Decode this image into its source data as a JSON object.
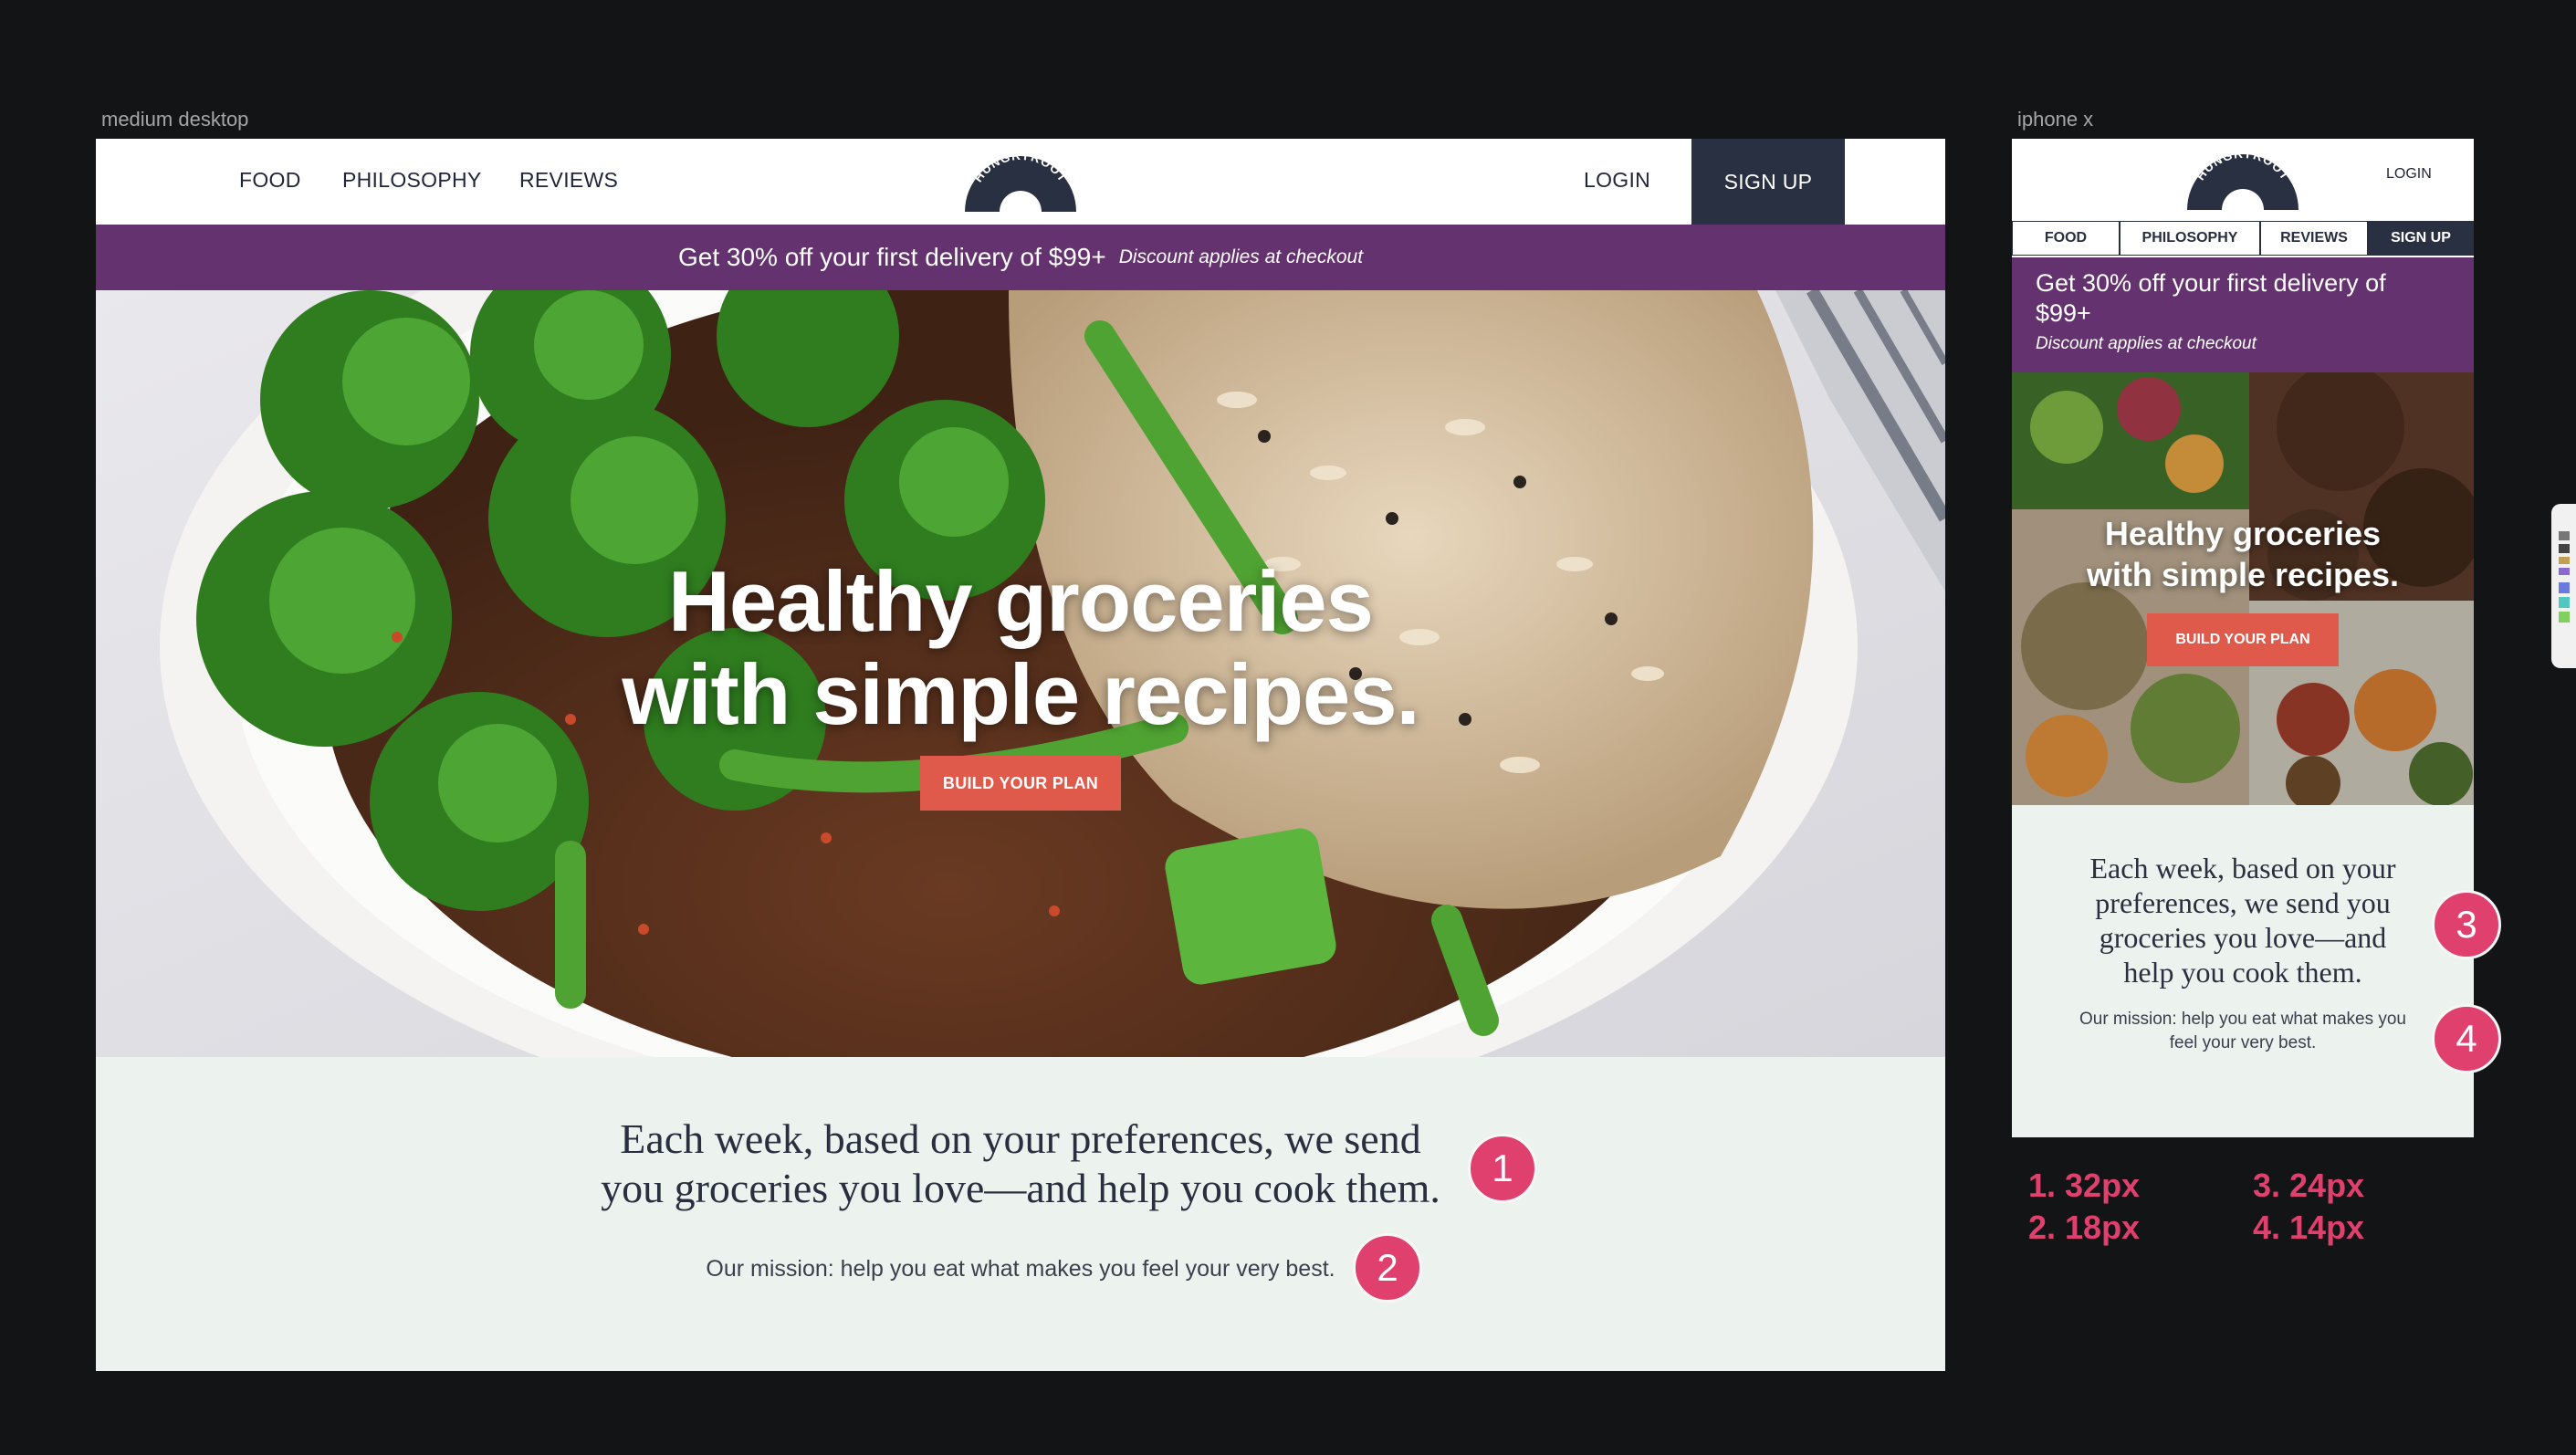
{
  "frames": {
    "desktop_label": "medium desktop",
    "mobile_label": "iphone x"
  },
  "brand": {
    "logo_text": "HUNGRYROOT",
    "navy": "#293041",
    "purple": "#64326e",
    "coral": "#e05a4b",
    "mint": "#ecf3ef",
    "annotation_pink": "#e0406e"
  },
  "desktop": {
    "nav": {
      "food": "FOOD",
      "philosophy": "PHILOSOPHY",
      "reviews": "REVIEWS",
      "login": "LOGIN",
      "signup": "SIGN UP"
    },
    "promo": {
      "main": "Get 30% off your first delivery of $99+",
      "sub": "Discount applies at checkout"
    },
    "hero": {
      "line1": "Healthy groceries",
      "line2": "with simple recipes.",
      "cta": "BUILD YOUR PLAN"
    },
    "lead": {
      "line1": "Each week, based on your preferences, we send",
      "line2": "you groceries you love—and help you cook them."
    },
    "mission": "Our mission: help you eat what makes you feel your very best."
  },
  "mobile": {
    "login": "LOGIN",
    "tabs": [
      "FOOD",
      "PHILOSOPHY",
      "REVIEWS",
      "SIGN UP"
    ],
    "promo": {
      "line1": "Get 30% off your first delivery of",
      "line2": "$99+",
      "sub": "Discount applies at checkout"
    },
    "hero": {
      "line1": "Healthy groceries",
      "line2": "with simple recipes.",
      "cta": "BUILD YOUR PLAN"
    },
    "lead": {
      "line1": "Each week, based on your",
      "line2": "preferences, we send you",
      "line3": "groceries you love—and",
      "line4": "help you cook them."
    },
    "mission": {
      "line1": "Our mission: help you eat what makes you",
      "line2": "feel your very best."
    }
  },
  "annotations": {
    "badges": [
      "1",
      "2",
      "3",
      "4"
    ],
    "legend": {
      "l1": "1. 32px",
      "l2": "2. 18px",
      "l3": "3. 24px",
      "l4": "4. 14px"
    }
  }
}
